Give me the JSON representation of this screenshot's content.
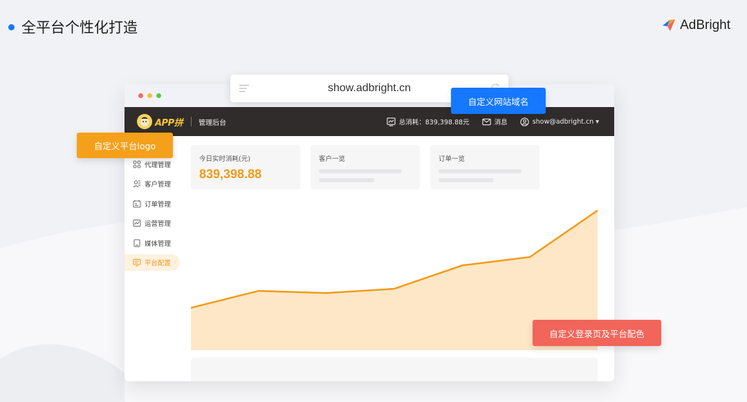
{
  "slide": {
    "title": "全平台个性化打造"
  },
  "brand": {
    "name": "AdBright"
  },
  "url": {
    "value": "show.adbright.cn"
  },
  "header": {
    "app_logo_text": "APP拼",
    "admin_label": "管理后台",
    "total_cost": "总消耗：839,398.88元",
    "messages": "消息",
    "account": "show@adbright.cn ▾"
  },
  "sidebar": {
    "items": [
      {
        "label": "代理管理",
        "icon": "grid-icon"
      },
      {
        "label": "客户管理",
        "icon": "users-icon"
      },
      {
        "label": "订单管理",
        "icon": "order-icon"
      },
      {
        "label": "运营管理",
        "icon": "operation-icon"
      },
      {
        "label": "媒体管理",
        "icon": "media-icon"
      },
      {
        "label": "平台配置",
        "icon": "config-icon",
        "active": true
      }
    ]
  },
  "cards": {
    "realtime": {
      "title": "今日实时消耗(元)",
      "value": "839,398.88"
    },
    "customers": {
      "title": "客户一览"
    },
    "orders": {
      "title": "订单一览"
    }
  },
  "callouts": {
    "domain": "自定义网站域名",
    "logo": "自定义平台logo",
    "login": "自定义登录页及平台配色"
  },
  "colors": {
    "accent_orange": "#f29a1a",
    "header_dark": "#2f2c2b",
    "callout_blue": "#1677ff",
    "callout_orange": "#f5a01b",
    "callout_red": "#f1655a"
  },
  "chart_data": {
    "type": "area",
    "title": "",
    "xlabel": "",
    "ylabel": "",
    "x": [
      0,
      1,
      2,
      3,
      4,
      5,
      6
    ],
    "series": [
      {
        "values": [
          20,
          28,
          27,
          29,
          40,
          44,
          66
        ]
      }
    ],
    "ylim": [
      0,
      75
    ],
    "grid": false
  }
}
